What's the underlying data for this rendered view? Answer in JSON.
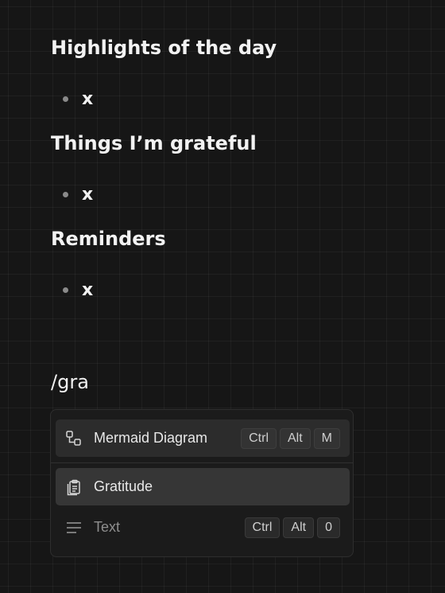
{
  "sections": [
    {
      "heading": "Highlights of the day",
      "bullet": "x"
    },
    {
      "heading": "Things I’m grateful",
      "bullet": "x"
    },
    {
      "heading": "Reminders",
      "bullet": "x"
    }
  ],
  "slash_command": "/gra",
  "menu": {
    "items": [
      {
        "label": "Mermaid Diagram",
        "icon": "diagram-icon",
        "keys": [
          "Ctrl",
          "Alt",
          "M"
        ],
        "state": "hover"
      },
      {
        "label": "Gratitude",
        "icon": "clipboard-icon",
        "keys": [],
        "state": "selected"
      },
      {
        "label": "Text",
        "icon": "text-lines-icon",
        "keys": [
          "Ctrl",
          "Alt",
          "0"
        ],
        "state": "normal"
      }
    ]
  },
  "colors": {
    "background": "#161616",
    "menu_bg": "#1b1b1b",
    "selected_item": "#363636",
    "hover_item": "#2c2c2c"
  }
}
